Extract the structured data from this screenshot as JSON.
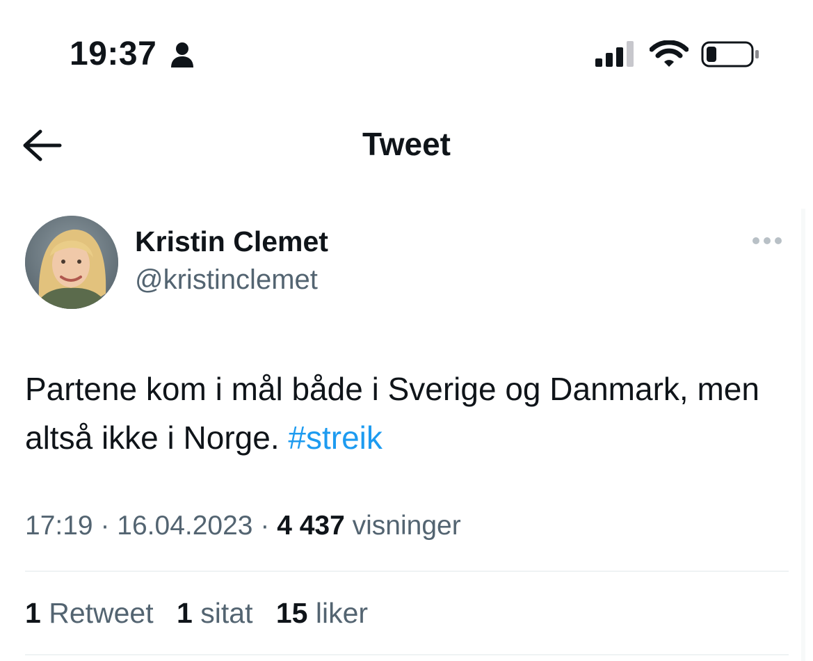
{
  "status_bar": {
    "time": "19:37",
    "icons": [
      "person-icon",
      "signal-icon",
      "wifi-icon",
      "battery-icon"
    ]
  },
  "header": {
    "title": "Tweet",
    "back_icon": "arrow-left-icon"
  },
  "tweet": {
    "author": {
      "display_name": "Kristin Clemet",
      "handle": "@kristinclemet"
    },
    "text": "Partene kom i mål både i Sverige og Danmark, men altså ikke i Norge.",
    "hashtag": "#streik",
    "time": "17:19",
    "separator": "·",
    "date": "16.04.2023",
    "views_count": "4 437",
    "views_label": "visninger",
    "stats": {
      "retweets_count": "1",
      "retweets_label": "Retweet",
      "quotes_count": "1",
      "quotes_label": "sitat",
      "likes_count": "15",
      "likes_label": "liker"
    }
  },
  "colors": {
    "text": "#0f1419",
    "secondary": "#536471",
    "link": "#1d9bf0",
    "divider": "#eff3f4"
  }
}
